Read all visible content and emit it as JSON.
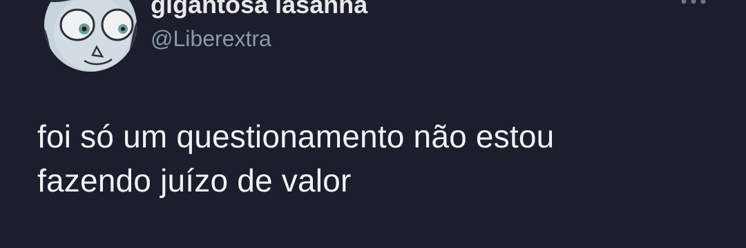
{
  "tweet": {
    "author": {
      "display_name": "gigantosa lasanha",
      "handle": "@Liberextra",
      "avatar_icon": "cartoon-character-avatar"
    },
    "more_icon": "more-horizontal-icon",
    "text_lines": [
      "foi só um questionamento não estou",
      "fazendo juízo de valor"
    ]
  },
  "colors": {
    "background": "#1a1f2b",
    "text_primary": "#e7e9ea",
    "text_secondary": "#8b98a5"
  }
}
